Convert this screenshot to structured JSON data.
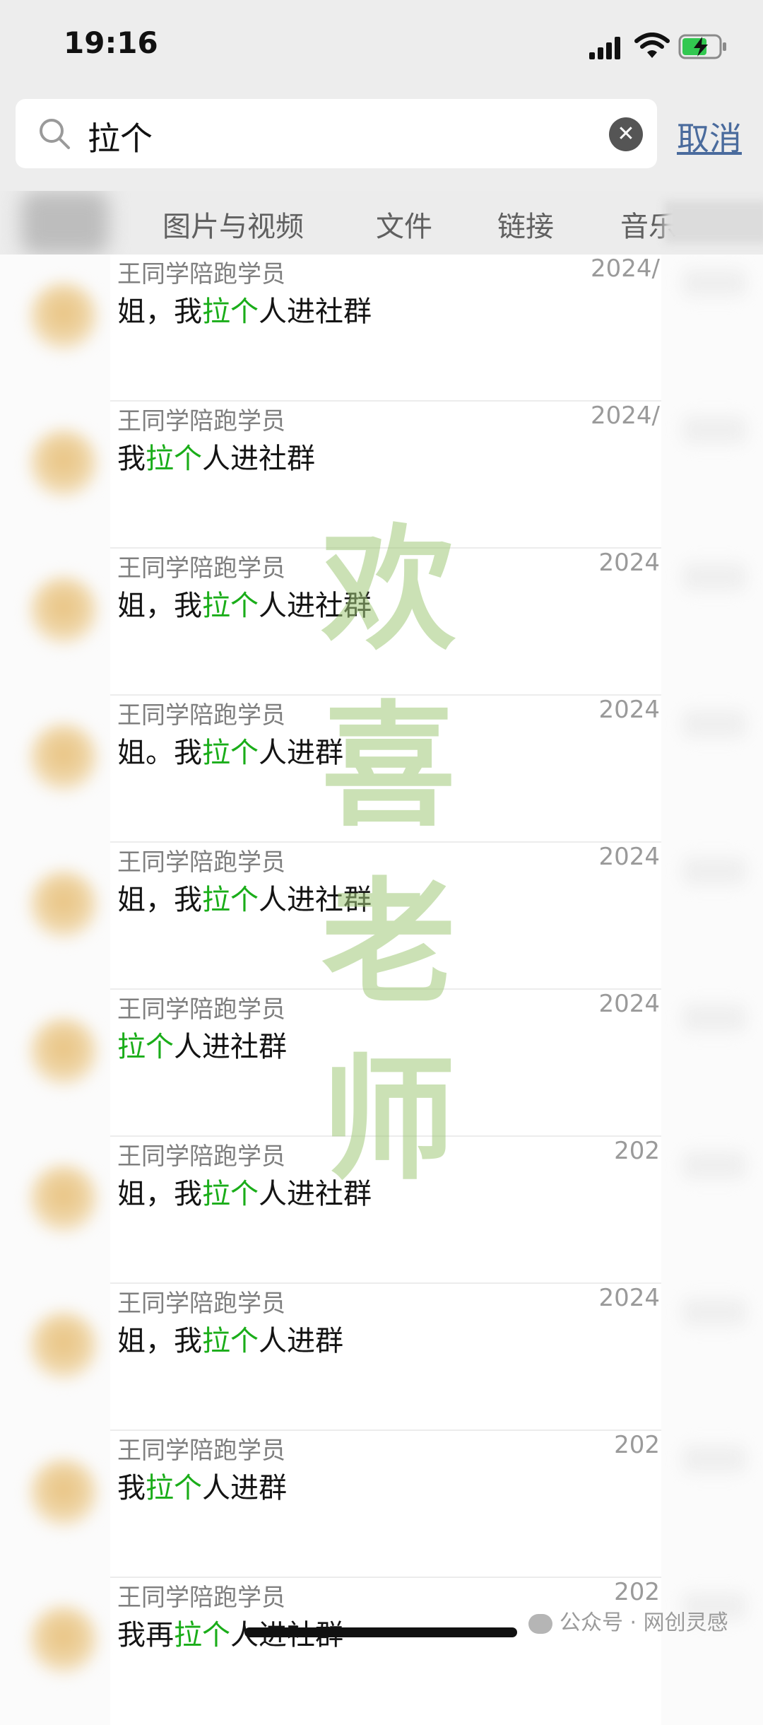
{
  "status_bar": {
    "time": "19:16"
  },
  "search": {
    "query": "拉个",
    "cancel_label": "取消"
  },
  "tabs": [
    {
      "label": "图片与视频"
    },
    {
      "label": "文件"
    },
    {
      "label": "链接"
    },
    {
      "label": "音乐"
    }
  ],
  "results": [
    {
      "name": "王同学陪跑学员",
      "date": "2024/",
      "pre": "姐，我",
      "hl": "拉个",
      "post": "人进社群"
    },
    {
      "name": "王同学陪跑学员",
      "date": "2024/",
      "pre": "我",
      "hl": "拉个",
      "post": "人进社群"
    },
    {
      "name": "王同学陪跑学员",
      "date": "2024",
      "pre": "姐，我",
      "hl": "拉个",
      "post": "人进社群"
    },
    {
      "name": "王同学陪跑学员",
      "date": "2024",
      "pre": "姐。我",
      "hl": "拉个",
      "post": "人进群"
    },
    {
      "name": "王同学陪跑学员",
      "date": "2024",
      "pre": "姐，我",
      "hl": "拉个",
      "post": "人进社群"
    },
    {
      "name": "王同学陪跑学员",
      "date": "2024",
      "pre": "",
      "hl": "拉个",
      "post": "人进社群"
    },
    {
      "name": "王同学陪跑学员",
      "date": "202",
      "pre": "姐，我",
      "hl": "拉个",
      "post": "人进社群"
    },
    {
      "name": "王同学陪跑学员",
      "date": "2024",
      "pre": "姐，我",
      "hl": "拉个",
      "post": "人进群"
    },
    {
      "name": "王同学陪跑学员",
      "date": "202",
      "pre": "我",
      "hl": "拉个",
      "post": "人进群"
    },
    {
      "name": "王同学陪跑学员",
      "date": "202",
      "pre": "我再",
      "hl": "拉个",
      "post": "人进社群"
    }
  ],
  "watermark": [
    "欢",
    "喜",
    "老",
    "师"
  ],
  "footer": {
    "wechat_account": "公众号 · 网创灵感"
  },
  "colors": {
    "highlight": "#1aad19",
    "cancel": "#4a6b9d"
  }
}
